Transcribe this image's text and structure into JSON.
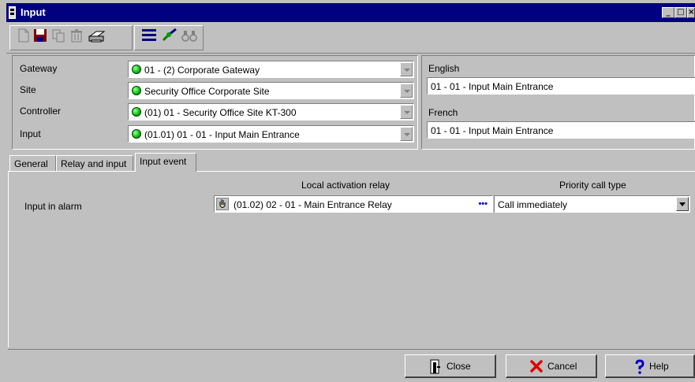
{
  "window": {
    "title": "Input",
    "controls": [
      "_",
      "□",
      "×"
    ]
  },
  "toolbar": {
    "buttons": [
      {
        "icon": "new-document-icon"
      },
      {
        "icon": "save-icon"
      },
      {
        "icon": "copy-icon"
      },
      {
        "icon": "delete-icon"
      },
      {
        "icon": "print-icon"
      },
      {
        "icon": "list-icon"
      },
      {
        "icon": "link-icon"
      },
      {
        "icon": "binoculars-icon"
      }
    ]
  },
  "form": {
    "gateway": {
      "label": "Gateway",
      "value": "01 - (2)  Corporate Gateway"
    },
    "site": {
      "label": "Site",
      "value": "Security Office Corporate Site"
    },
    "controller": {
      "label": "Controller",
      "value": "(01) 01 - Security Office Site KT-300"
    },
    "input": {
      "label": "Input",
      "value": "(01.01) 01 - 01 - Input Main Entrance"
    }
  },
  "descriptions": {
    "english": {
      "label": "English",
      "value": "01 - 01 - Input Main Entrance"
    },
    "french": {
      "label": "French",
      "value": "01 - 01 - Input Main Entrance"
    }
  },
  "tabs": [
    {
      "label": "General"
    },
    {
      "label": "Relay and input"
    },
    {
      "label": "Input event",
      "active": true
    }
  ],
  "input_event": {
    "col_relay_header": "Local activation relay",
    "col_priority_header": "Priority call type",
    "row_label": "Input in alarm",
    "relay_value": "(01.02) 02 - 01 - Main Entrance Relay",
    "relay_browse": "•••",
    "priority_value": "Call immediately"
  },
  "buttons": {
    "close": "Close",
    "cancel": "Cancel",
    "help": "Help"
  },
  "colors": {
    "titlebar": "#000080",
    "face": "#c0c0c0",
    "status_ok": "#10c010"
  }
}
